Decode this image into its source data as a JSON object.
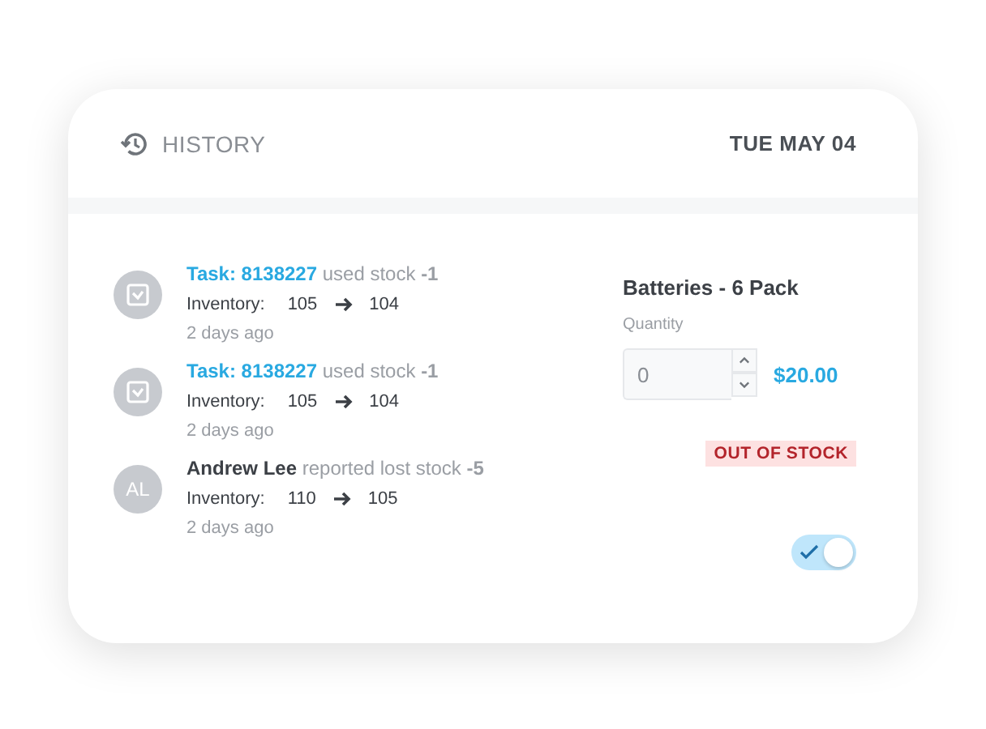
{
  "header": {
    "title": "HISTORY",
    "date": "TUE MAY 04"
  },
  "activities": [
    {
      "kind": "task",
      "actor": "Task: 8138227",
      "action": "used stock **-1**",
      "inventory_label": "Inventory:",
      "from": "105",
      "to": "104",
      "time": "2 days ago"
    },
    {
      "kind": "task",
      "actor": "Task: 8138227",
      "action": "used stock **-1**",
      "inventory_label": "Inventory:",
      "from": "105",
      "to": "104",
      "time": "2 days ago"
    },
    {
      "kind": "person",
      "initials": "AL",
      "actor": "Andrew Lee",
      "action": "reported lost stock **-5**",
      "inventory_label": "Inventory:",
      "from": "110",
      "to": "105",
      "time": "2 days ago"
    }
  ],
  "product": {
    "name": "Batteries - 6 Pack",
    "quantity_label": "Quantity",
    "quantity": "0",
    "price": "$20.00",
    "status": "OUT OF STOCK",
    "toggle": {
      "on": true
    }
  }
}
